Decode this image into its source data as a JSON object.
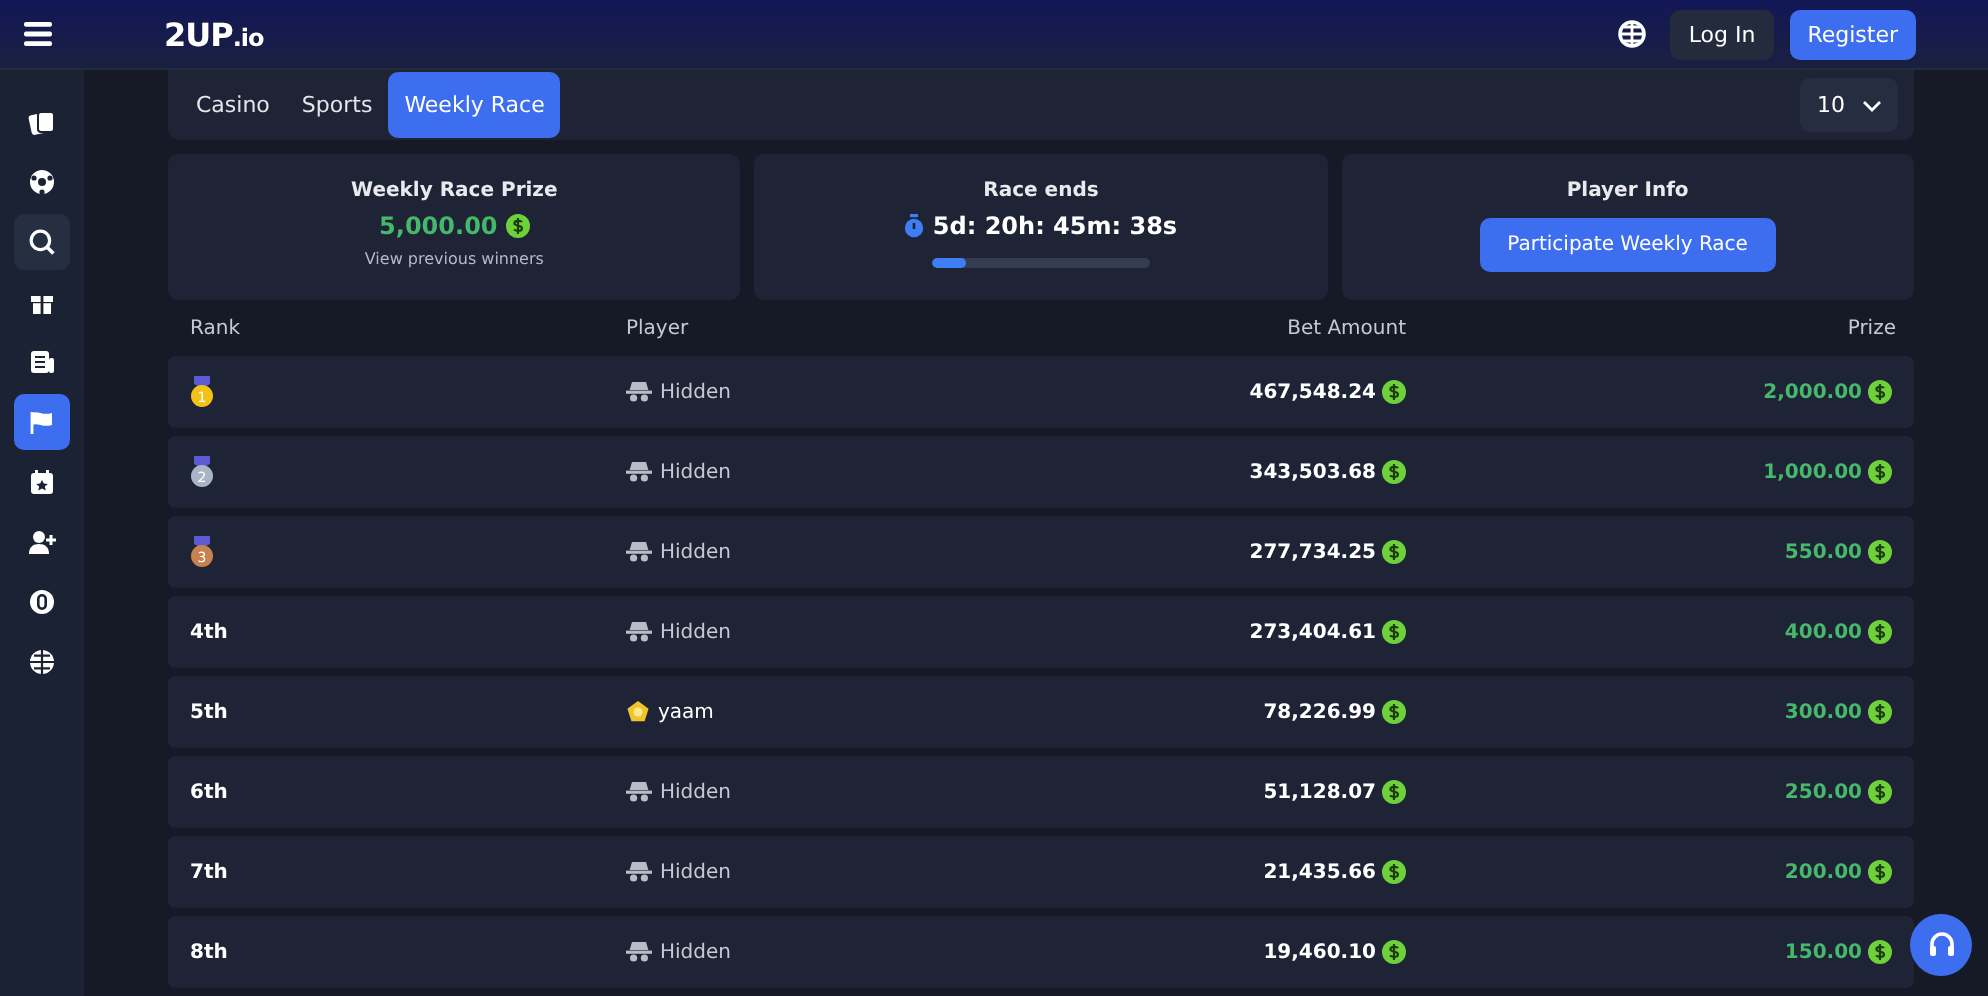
{
  "header": {
    "logo_main": "2UP",
    "logo_suffix": ".io",
    "login": "Log In",
    "register": "Register"
  },
  "sidebar": {
    "items": [
      {
        "selected": false
      },
      {
        "selected": false
      },
      {
        "selected": false
      },
      {
        "selected": false
      },
      {
        "selected": false
      },
      {
        "selected": true
      },
      {
        "selected": false
      },
      {
        "selected": false
      },
      {
        "selected": false
      },
      {
        "selected": false
      }
    ]
  },
  "tabs": [
    {
      "label": "Casino",
      "selected": false
    },
    {
      "label": "Sports",
      "selected": false
    },
    {
      "label": "Weekly Race",
      "selected": true
    }
  ],
  "page_size": {
    "value": "10"
  },
  "prize_card": {
    "title": "Weekly Race Prize",
    "amount": "5,000.00",
    "link": "View previous winners"
  },
  "timer_card": {
    "title": "Race ends",
    "countdown": "5d: 20h: 45m: 38s",
    "level": 0.16
  },
  "player_card": {
    "title": "Player Info",
    "button": "Participate Weekly Race"
  },
  "table": {
    "columns": [
      "Rank",
      "Player",
      "Bet Amount",
      "Prize"
    ],
    "rows": [
      {
        "rank": {
          "kind": "medal",
          "text": "1",
          "color": "#f2c316"
        },
        "player": {
          "kind": "hidden",
          "name": "Hidden"
        },
        "bet": "467,548.24",
        "prize": "2,000.00"
      },
      {
        "rank": {
          "kind": "medal",
          "text": "2",
          "color": "#a9b4c6"
        },
        "player": {
          "kind": "hidden",
          "name": "Hidden"
        },
        "bet": "343,503.68",
        "prize": "1,000.00"
      },
      {
        "rank": {
          "kind": "medal",
          "text": "3",
          "color": "#c7824f"
        },
        "player": {
          "kind": "hidden",
          "name": "Hidden"
        },
        "bet": "277,734.25",
        "prize": "550.00"
      },
      {
        "rank": {
          "kind": "text",
          "text": "4th"
        },
        "player": {
          "kind": "hidden",
          "name": "Hidden"
        },
        "bet": "273,404.61",
        "prize": "400.00"
      },
      {
        "rank": {
          "kind": "text",
          "text": "5th"
        },
        "player": {
          "kind": "user",
          "name": "yaam"
        },
        "bet": "78,226.99",
        "prize": "300.00"
      },
      {
        "rank": {
          "kind": "text",
          "text": "6th"
        },
        "player": {
          "kind": "hidden",
          "name": "Hidden"
        },
        "bet": "51,128.07",
        "prize": "250.00"
      },
      {
        "rank": {
          "kind": "text",
          "text": "7th"
        },
        "player": {
          "kind": "hidden",
          "name": "Hidden"
        },
        "bet": "21,435.66",
        "prize": "200.00"
      },
      {
        "rank": {
          "kind": "text",
          "text": "8th"
        },
        "player": {
          "kind": "hidden",
          "name": "Hidden"
        },
        "bet": "19,460.10",
        "prize": "150.00"
      }
    ]
  }
}
